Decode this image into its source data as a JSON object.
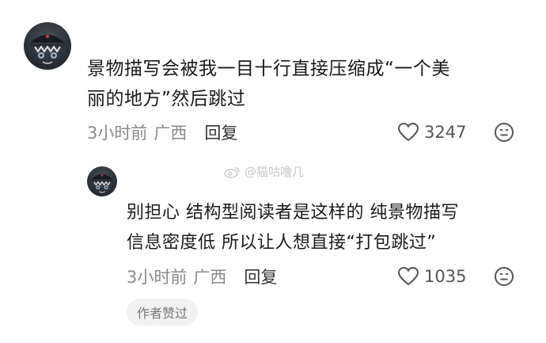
{
  "comment1": {
    "text_line1": "景物描写会被我一目十行直接压缩成“一个美",
    "text_line2": "丽的地方”然后跳过",
    "time": "3小时前",
    "location": "广西",
    "reply_label": "回复",
    "likes": "3247"
  },
  "comment2": {
    "text_line1": "别担心 结构型阅读者是这样的 纯景物描写",
    "text_line2": "信息密度低 所以让人想直接“打包跳过”",
    "time": "3小时前",
    "location": "广西",
    "reply_label": "回复",
    "likes": "1035",
    "author_badge": "作者赞过"
  },
  "watermark": {
    "text": "@猫咕噜几"
  },
  "icons": {
    "like": "heart-outline-icon",
    "dislike": "neutral-face-icon",
    "avatar": "masked-character-avatar"
  }
}
